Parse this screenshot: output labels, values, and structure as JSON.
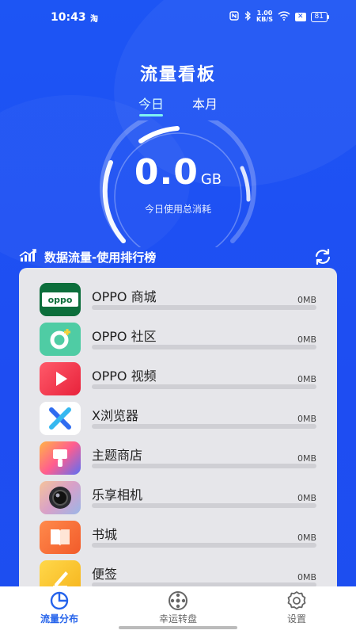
{
  "status_bar": {
    "time": "10:43",
    "app_indicator": "淘",
    "speed_value": "1.00",
    "speed_unit": "KB/S",
    "battery": "81"
  },
  "header": {
    "title": "流量看板",
    "tabs": [
      {
        "label": "今日",
        "active": true
      },
      {
        "label": "本月",
        "active": false
      }
    ]
  },
  "gauge": {
    "value": "0.0",
    "unit": "GB",
    "caption": "今日使用总消耗"
  },
  "ranking": {
    "title": "数据流量-使用排行榜",
    "items": [
      {
        "name": "OPPO 商城",
        "usage": "0MB",
        "icon": "oppo-store-icon"
      },
      {
        "name": "OPPO 社区",
        "usage": "0MB",
        "icon": "oppo-community-icon"
      },
      {
        "name": "OPPO 视频",
        "usage": "0MB",
        "icon": "oppo-video-icon"
      },
      {
        "name": "X浏览器",
        "usage": "0MB",
        "icon": "x-browser-icon"
      },
      {
        "name": "主题商店",
        "usage": "0MB",
        "icon": "theme-store-icon"
      },
      {
        "name": "乐享相机",
        "usage": "0MB",
        "icon": "camera-icon"
      },
      {
        "name": "书城",
        "usage": "0MB",
        "icon": "book-city-icon"
      },
      {
        "name": "便签",
        "usage": "0MB",
        "icon": "notes-icon"
      }
    ]
  },
  "bottom_nav": [
    {
      "label": "流量分布",
      "active": true,
      "icon": "pie-chart-icon"
    },
    {
      "label": "幸运转盘",
      "active": false,
      "icon": "wheel-icon"
    },
    {
      "label": "设置",
      "active": false,
      "icon": "settings-icon"
    }
  ],
  "colors": {
    "background": "#1d55f4",
    "accent": "#2563eb",
    "tab_underline": "#7ff2f2"
  }
}
